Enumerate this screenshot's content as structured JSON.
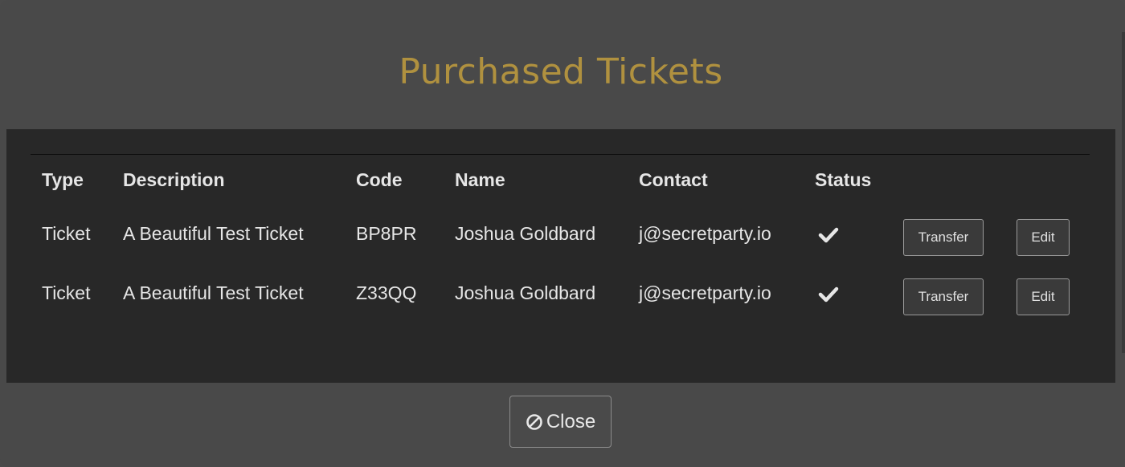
{
  "modal": {
    "title": "Purchased Tickets",
    "close_label": "Close",
    "close_icon": "ban-icon"
  },
  "table": {
    "headers": {
      "type": "Type",
      "description": "Description",
      "code": "Code",
      "name": "Name",
      "contact": "Contact",
      "status": "Status"
    },
    "rows": [
      {
        "type": "Ticket",
        "description": "A Beautiful Test Ticket",
        "code": "BP8PR",
        "name": "Joshua Goldbard",
        "contact": "j@secretparty.io",
        "status_icon": "checkmark-icon",
        "transfer_label": "Transfer",
        "edit_label": "Edit"
      },
      {
        "type": "Ticket",
        "description": "A Beautiful Test Ticket",
        "code": "Z33QQ",
        "name": "Joshua Goldbard",
        "contact": "j@secretparty.io",
        "status_icon": "checkmark-icon",
        "transfer_label": "Transfer",
        "edit_label": "Edit"
      }
    ]
  },
  "colors": {
    "title": "#b0913f",
    "modal_bg": "#494949",
    "panel_bg": "#282828"
  }
}
